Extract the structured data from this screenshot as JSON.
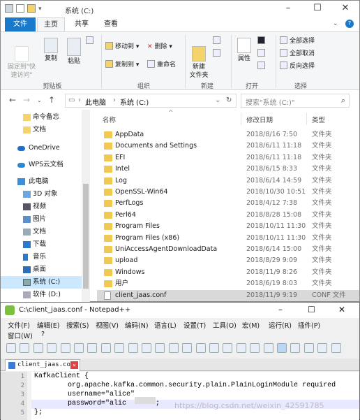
{
  "explorer": {
    "title": "系统 (C:)",
    "tabs": [
      "文件",
      "主页",
      "共享",
      "查看"
    ],
    "ribbon": {
      "pin": "固定到\"快\n速访问\"",
      "copy": "复制",
      "paste": "粘贴",
      "move_to": "移动到",
      "delete": "删除",
      "copy_to": "复制到",
      "rename": "重命名",
      "new_folder": "新建\n文件夹",
      "properties": "属性",
      "select_all": "全部选择",
      "select_none": "全部取消",
      "invert": "反向选择",
      "groups": [
        "剪贴板",
        "组织",
        "新建",
        "打开",
        "选择"
      ]
    },
    "address": {
      "part1": "此电脑",
      "part2": "系统 (C:)"
    },
    "search_placeholder": "搜索\"系统 (C:)\"",
    "nav_items": [
      {
        "label": "命令备忘"
      },
      {
        "label": "文档"
      },
      {
        "label": "OneDrive"
      },
      {
        "label": "WPS云文档"
      },
      {
        "label": "此电脑"
      },
      {
        "label": "3D 对象"
      },
      {
        "label": "视频"
      },
      {
        "label": "图片"
      },
      {
        "label": "文档"
      },
      {
        "label": "下载"
      },
      {
        "label": "音乐"
      },
      {
        "label": "桌面"
      },
      {
        "label": "系统 (C:)"
      },
      {
        "label": "软件 (D:)"
      }
    ],
    "columns": {
      "name": "名称",
      "date": "修改日期",
      "type": "类型"
    },
    "files": [
      {
        "name": "AppData",
        "date": "2018/8/16 7:50",
        "type": "文件夹"
      },
      {
        "name": "Documents and Settings",
        "date": "2018/6/11 11:18",
        "type": "文件夹"
      },
      {
        "name": "EFI",
        "date": "2018/6/11 11:18",
        "type": "文件夹"
      },
      {
        "name": "Intel",
        "date": "2018/6/15 8:33",
        "type": "文件夹"
      },
      {
        "name": "Log",
        "date": "2018/6/14 14:59",
        "type": "文件夹"
      },
      {
        "name": "OpenSSL-Win64",
        "date": "2018/10/30 10:51",
        "type": "文件夹"
      },
      {
        "name": "PerfLogs",
        "date": "2018/4/12 7:38",
        "type": "文件夹"
      },
      {
        "name": "Perl64",
        "date": "2018/8/28 15:08",
        "type": "文件夹"
      },
      {
        "name": "Program Files",
        "date": "2018/10/11 11:30",
        "type": "文件夹"
      },
      {
        "name": "Program Files (x86)",
        "date": "2018/10/11 11:30",
        "type": "文件夹"
      },
      {
        "name": "UniAccessAgentDownloadData",
        "date": "2018/6/14 15:00",
        "type": "文件夹"
      },
      {
        "name": "upload",
        "date": "2018/8/29 9:09",
        "type": "文件夹"
      },
      {
        "name": "Windows",
        "date": "2018/11/9 8:26",
        "type": "文件夹"
      },
      {
        "name": "用户",
        "date": "2018/6/19 8:03",
        "type": "文件夹"
      },
      {
        "name": "client_jaas.conf",
        "date": "2018/11/9 9:19",
        "type": "CONF 文件"
      }
    ]
  },
  "notepad": {
    "title": "C:\\client_jaas.conf - Notepad++",
    "menu1": [
      "文件(F)",
      "编辑(E)",
      "搜索(S)",
      "视图(V)",
      "编码(N)",
      "语言(L)",
      "设置(T)",
      "工具(O)",
      "宏(M)",
      "运行(R)",
      "插件(P)"
    ],
    "menu2": [
      "窗口(W)",
      "?"
    ],
    "tab": "client_jaas.conf",
    "lines": [
      {
        "num": "1",
        "text": "KafkaClient {"
      },
      {
        "num": "2",
        "text": "        org.apache.kafka.common.security.plain.PlainLoginModule required"
      },
      {
        "num": "3",
        "text": "        username=\"alice\""
      },
      {
        "num": "4",
        "text": "        password=\"alic      \";"
      },
      {
        "num": "5",
        "text": "};"
      }
    ]
  },
  "watermark": "https://blog.csdn.net/weixin_42591785"
}
